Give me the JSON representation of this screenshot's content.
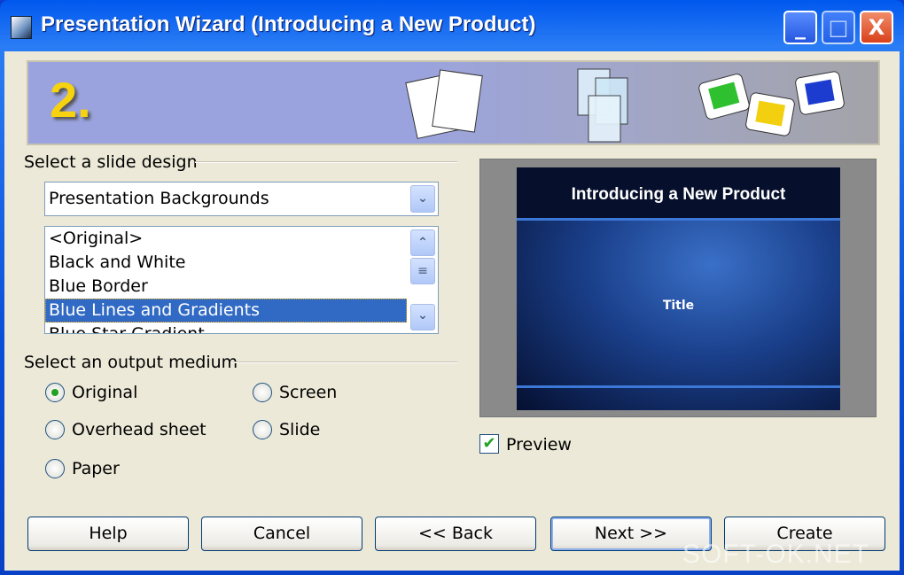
{
  "window": {
    "title": "Presentation Wizard (Introducing a New Product)",
    "minimize": "_",
    "maximize": "□",
    "close": "X"
  },
  "banner": {
    "step": "2."
  },
  "design": {
    "group_label": "Select a slide design",
    "category": "Presentation Backgrounds",
    "items": [
      "<Original>",
      "Black and White",
      "Blue Border",
      "Blue Lines and Gradients",
      "Blue Star Gradient"
    ],
    "selected": "Blue Lines and Gradients"
  },
  "output": {
    "group_label": "Select an output medium",
    "options": [
      "Original",
      "Overhead sheet",
      "Paper",
      "Screen",
      "Slide"
    ],
    "selected": "Original"
  },
  "preview": {
    "slide_title": "Introducing a New Product",
    "slide_subtitle": "Title",
    "checkbox_label": "Preview",
    "checked": true
  },
  "buttons": {
    "help": "Help",
    "cancel": "Cancel",
    "back": "<< Back",
    "next": "Next >>",
    "create": "Create"
  },
  "watermark": "SOFT-OK.NET"
}
